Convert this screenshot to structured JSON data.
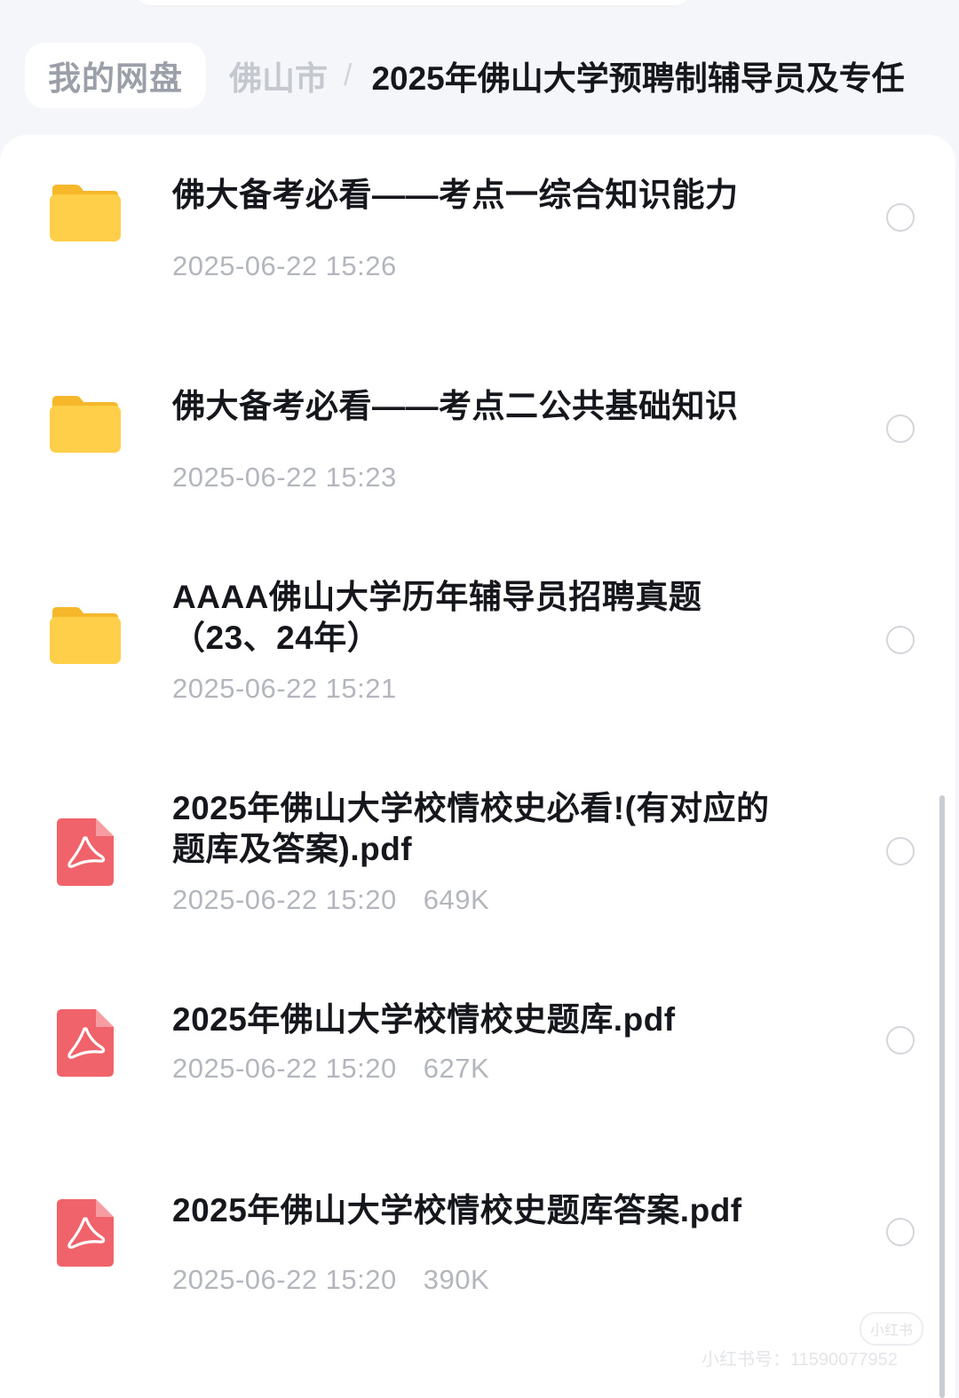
{
  "breadcrumb": {
    "home": "我的网盘",
    "parent": "佛山市",
    "separator": "/",
    "current": "2025年佛山大学预聘制辅导员及专任"
  },
  "files": [
    {
      "type": "folder",
      "icon": "folder-icon",
      "name": "佛大备考必看——考点一综合知识能力",
      "date": "2025-06-22 15:26",
      "size": ""
    },
    {
      "type": "folder",
      "icon": "folder-icon",
      "name": "佛大备考必看——考点二公共基础知识",
      "date": "2025-06-22 15:23",
      "size": ""
    },
    {
      "type": "folder",
      "icon": "folder-icon",
      "name": "AAAA佛山大学历年辅导员招聘真题（23、24年）",
      "date": "2025-06-22 15:21",
      "size": ""
    },
    {
      "type": "pdf",
      "icon": "pdf-icon",
      "name": "2025年佛山大学校情校史必看!(有对应的题库及答案).pdf",
      "date": "2025-06-22 15:20",
      "size": "649K"
    },
    {
      "type": "pdf",
      "icon": "pdf-icon",
      "name": "2025年佛山大学校情校史题库.pdf",
      "date": "2025-06-22 15:20",
      "size": "627K"
    },
    {
      "type": "pdf",
      "icon": "pdf-icon",
      "name": "2025年佛山大学校情校史题库答案.pdf",
      "date": "2025-06-22 15:20",
      "size": "390K"
    }
  ],
  "watermark": {
    "logo": "小红书",
    "text": "小红书号：1159007795​2"
  },
  "colors": {
    "folder": "#ffcf4a",
    "pdf": "#f0636b",
    "text_primary": "#15171c",
    "text_secondary": "#b3b7bd",
    "background": "#f4f6f9"
  }
}
